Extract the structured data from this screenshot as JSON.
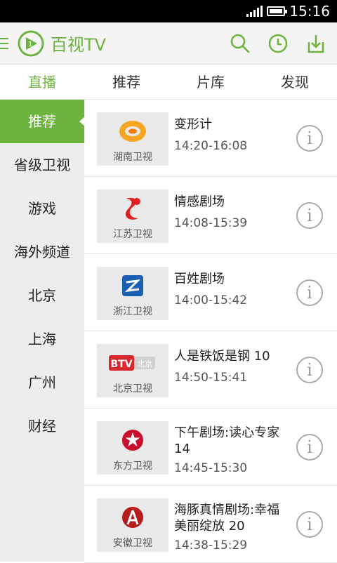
{
  "status": {
    "time": "15:16"
  },
  "app": {
    "title": "百视TV"
  },
  "tabs": [
    {
      "label": "直播",
      "active": true
    },
    {
      "label": "推荐"
    },
    {
      "label": "片库"
    },
    {
      "label": "发现"
    }
  ],
  "sidebar": [
    {
      "label": "推荐",
      "active": true
    },
    {
      "label": "省级卫视"
    },
    {
      "label": "游戏"
    },
    {
      "label": "海外频道"
    },
    {
      "label": "北京"
    },
    {
      "label": "上海"
    },
    {
      "label": "广州"
    },
    {
      "label": "财经"
    }
  ],
  "channels": [
    {
      "channel": "湖南卫视",
      "program": "变形计",
      "time": "14:20-16:08"
    },
    {
      "channel": "江苏卫视",
      "program": "情感剧场",
      "time": "14:08-15:39"
    },
    {
      "channel": "浙江卫视",
      "program": "百姓剧场",
      "time": "14:00-15:42"
    },
    {
      "channel": "北京卫视",
      "program": "人是铁饭是钢 10",
      "time": "14:50-15:41",
      "logo_text": "BTV",
      "logo_text2": "北京"
    },
    {
      "channel": "东方卫视",
      "program": "下午剧场:读心专家 14",
      "time": "14:45-15:30"
    },
    {
      "channel": "安徽卫视",
      "program": "海豚真情剧场:幸福美丽绽放 20",
      "time": "14:38-15:29"
    }
  ],
  "info_glyph": "i",
  "colors": {
    "accent": "#6db33f",
    "statusbar": "#000000",
    "sidebar_bg": "#ededed"
  }
}
